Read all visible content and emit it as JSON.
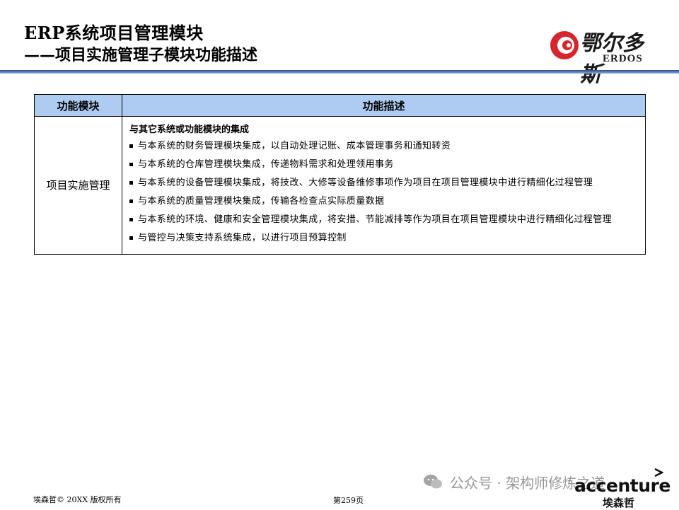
{
  "header": {
    "title_line1": "ERP系统项目管理模块",
    "title_line2": "——项目实施管理子模块功能描述",
    "logo_cn": "鄂尔多斯",
    "logo_en": "ERDOS"
  },
  "table": {
    "col_module": "功能模块",
    "col_desc": "功能描述",
    "row": {
      "module": "项目实施管理",
      "desc_head": "与其它系统或功能模块的集成",
      "items": [
        "与本系统的财务管理模块集成，以自动处理记账、成本管理事务和通知转资",
        "与本系统的仓库管理模块集成，传递物料需求和处理领用事务",
        "与本系统的设备管理模块集成，将技改、大修等设备维修事项作为项目在项目管理模块中进行精细化过程管理",
        "与本系统的质量管理模块集成，传输各检查点实际质量数据",
        "与本系统的环境、健康和安全管理模块集成，将安措、节能减排等作为项目在项目管理模块中进行精细化过程管理",
        "与管控与决策支持系统集成，以进行项目预算控制"
      ]
    }
  },
  "footer": {
    "copyright": "埃森哲©  20XX 版权所有",
    "page": "第259页",
    "watermark": "公众号 · 架构师修炼之道",
    "brand": "accenture",
    "brand_cn": "埃森哲"
  },
  "colors": {
    "header_bar": "#2f4f8f",
    "table_header_bg": "#aecbf1",
    "logo_red": "#d6262b"
  }
}
